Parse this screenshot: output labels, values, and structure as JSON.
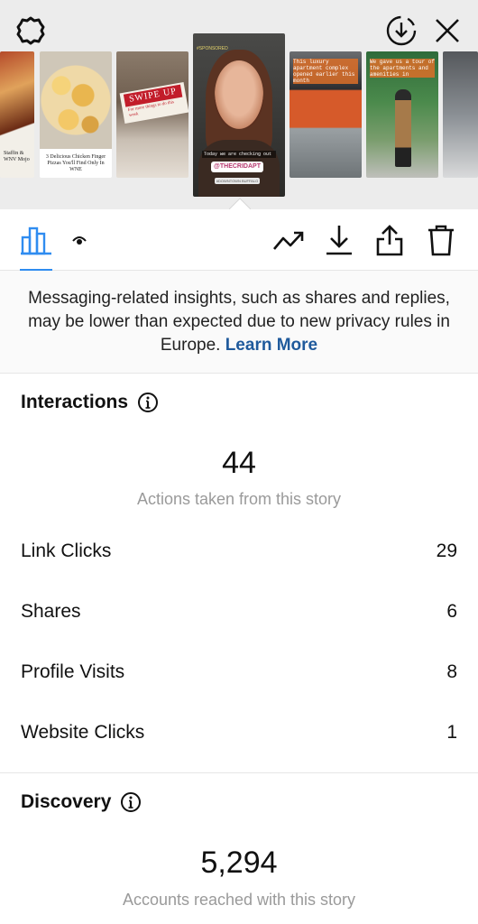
{
  "top_bar": {
    "settings_icon": "gear-icon",
    "download_icon": "download-circle-icon",
    "close_icon": "close-icon"
  },
  "stories": {
    "thumb_1_caption": "Staffin & WNV Mojo",
    "thumb_2_caption": "3 Delicious Chicken Finger Pizzas You'll Find Only In WNE",
    "thumb_3_banner": "SWIPE UP",
    "thumb_3_sub": "For more things to do this week",
    "selected": {
      "sponsored_label": "#SPONSORED",
      "text": "Today we are checking out",
      "mention": "@THECRIDAPT",
      "hashtag": "#DOWNTOWN BUFFALO"
    },
    "thumb_5_caption": "This luxury apartment complex opened earlier this month",
    "thumb_6_caption": "We gave us a tour of the apartments and amenities in"
  },
  "toolbar": {
    "insights_icon": "bar-chart-icon",
    "viewers_icon": "eye-icon",
    "promote_icon": "trend-up-icon",
    "save_icon": "download-icon",
    "share_icon": "share-icon",
    "delete_icon": "trash-icon"
  },
  "notice": {
    "text": "Messaging-related insights, such as shares and replies, may be lower than expected due to new privacy rules in Europe.",
    "link": "Learn More"
  },
  "interactions": {
    "title": "Interactions",
    "total": "44",
    "caption": "Actions taken from this story",
    "rows": [
      {
        "label": "Link Clicks",
        "value": "29"
      },
      {
        "label": "Shares",
        "value": "6"
      },
      {
        "label": "Profile Visits",
        "value": "8"
      },
      {
        "label": "Website Clicks",
        "value": "1"
      }
    ]
  },
  "discovery": {
    "title": "Discovery",
    "total": "5,294",
    "caption": "Accounts reached with this story"
  },
  "colors": {
    "accent_blue": "#2f8cf0",
    "link_blue": "#1f5a9c",
    "caption_gray": "#9a9a9a"
  }
}
